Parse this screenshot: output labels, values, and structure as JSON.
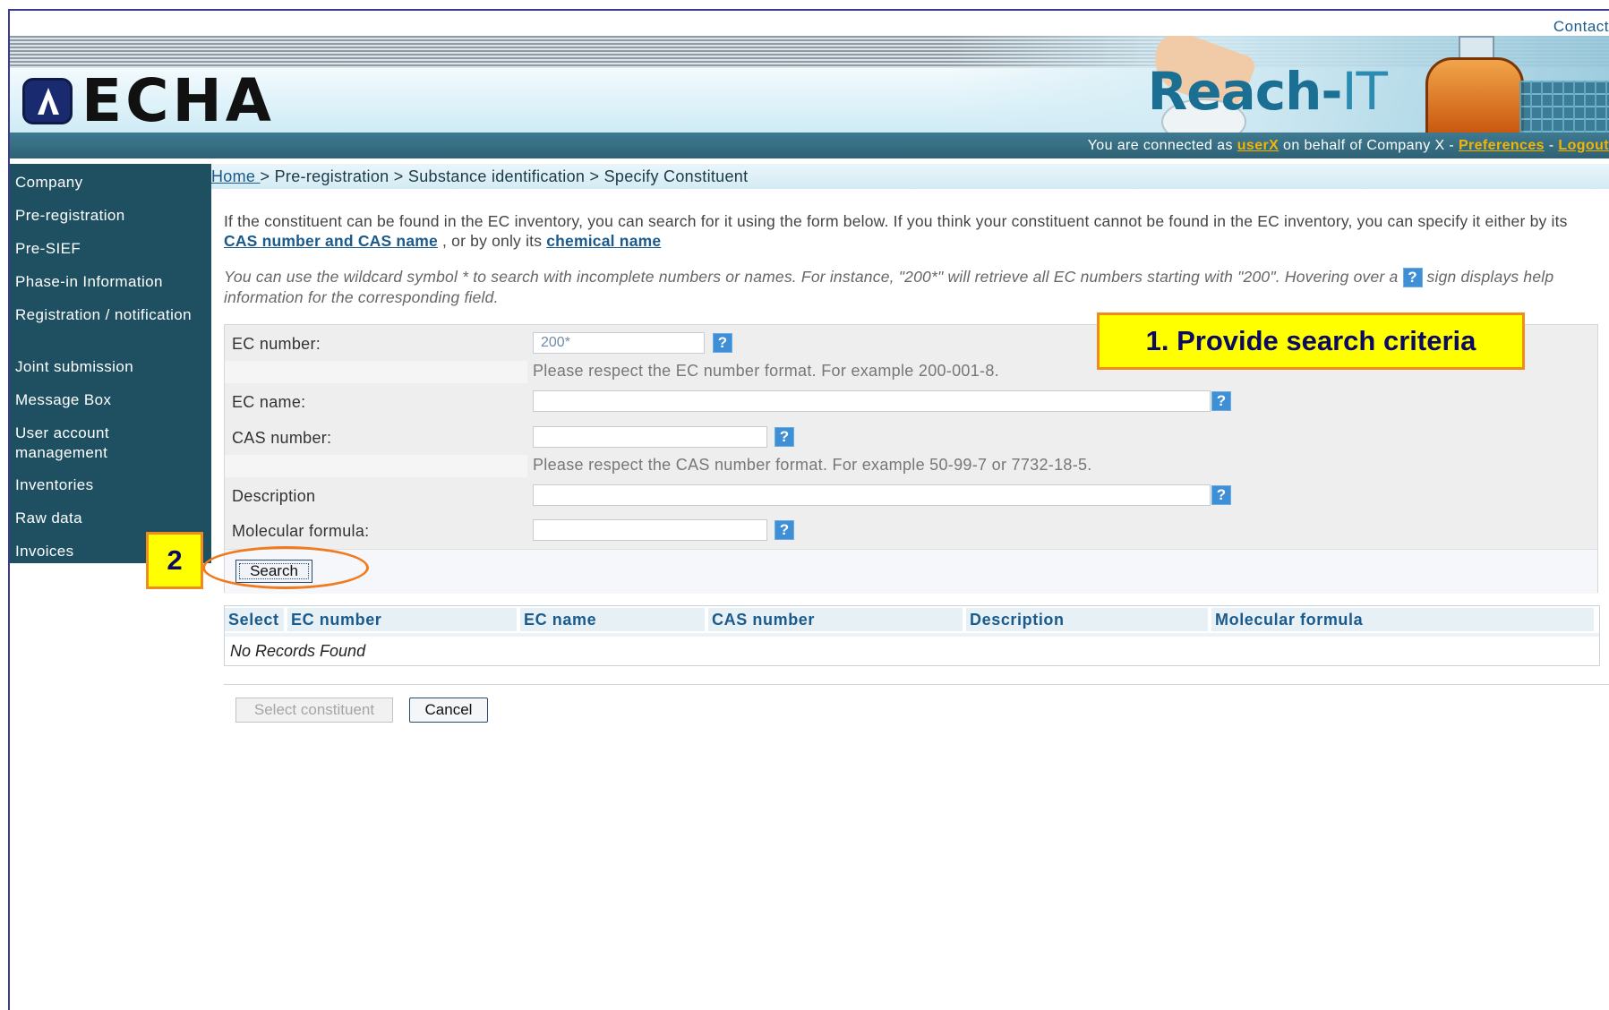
{
  "header": {
    "contact": "Contact",
    "logo_text": "ECHA",
    "app_title_main": "Reach-",
    "app_title_suffix": "IT",
    "status": {
      "prefix": "You are connected as ",
      "user": "userX",
      "middle": " on behalf of Company X - ",
      "preferences": "Preferences",
      "sep": " - ",
      "logout": "Logout"
    }
  },
  "sidebar": {
    "items": [
      {
        "label": "Company"
      },
      {
        "label": "Pre-registration"
      },
      {
        "label": "Pre-SIEF"
      },
      {
        "label": "Phase-in Information"
      },
      {
        "label": "Registration / notification"
      },
      {
        "label": "Joint submission"
      },
      {
        "label": "Message Box"
      },
      {
        "label": "User account management"
      },
      {
        "label": "Inventories"
      },
      {
        "label": "Raw data"
      },
      {
        "label": "Invoices"
      }
    ]
  },
  "breadcrumb": {
    "home": "Home ",
    "rest": "> Pre-registration > Substance identification > Specify Constituent"
  },
  "intro": {
    "text1": "If the constituent can be found in the EC inventory, you can search for it using the form below. If you think your constituent cannot be found in the EC inventory, you can specify it either by its ",
    "link1": "CAS number and CAS name",
    "text2": " , or by only its ",
    "link2": "chemical name"
  },
  "hint": {
    "text1": "You can use the wildcard symbol * to search with incomplete numbers or names. For instance, \"200*\" will retrieve all EC numbers starting with \"200\". Hovering over a ",
    "text2": " sign displays help information for the corresponding field."
  },
  "form": {
    "help_glyph": "?",
    "ec_number": {
      "label": "EC number:",
      "value": "200*",
      "note": "Please respect the EC number format. For example 200-001-8."
    },
    "ec_name": {
      "label": "EC name:",
      "value": ""
    },
    "cas_number": {
      "label": "CAS number:",
      "value": "",
      "note": "Please respect the CAS number format. For example 50-99-7 or 7732-18-5."
    },
    "description": {
      "label": "Description",
      "value": ""
    },
    "molecular_formula": {
      "label": "Molecular formula:",
      "value": ""
    },
    "search_button": "Search"
  },
  "callouts": {
    "step1": "1. Provide search criteria",
    "step2": "2"
  },
  "results": {
    "columns": [
      "Select",
      "EC number",
      "EC name",
      "CAS number",
      "Description",
      "Molecular formula"
    ],
    "empty_text": "No Records Found"
  },
  "actions": {
    "select": "Select constituent",
    "cancel": "Cancel"
  },
  "colors": {
    "sidebar_bg": "#1e5062",
    "link": "#1a5a8c",
    "callout_fill": "#ffff00",
    "callout_border": "#f08b1e",
    "user_link": "#f5b400"
  }
}
